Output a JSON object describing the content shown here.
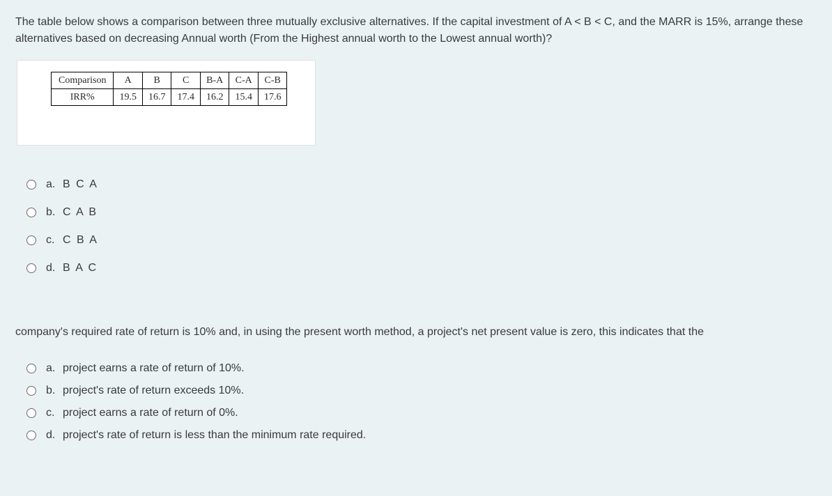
{
  "question1": {
    "text": "The table below shows a comparison between three mutually exclusive alternatives. If the capital investment of A < B < C, and the MARR is 15%, arrange these alternatives based on decreasing Annual worth (From the Highest annual worth to the Lowest annual worth)?",
    "table": {
      "row1": [
        "Comparison",
        "A",
        "B",
        "C",
        "B-A",
        "C-A",
        "C-B"
      ],
      "row2": [
        "IRR%",
        "19.5",
        "16.7",
        "17.4",
        "16.2",
        "15.4",
        "17.6"
      ]
    },
    "options": [
      {
        "letter": "a.",
        "text": "B C A"
      },
      {
        "letter": "b.",
        "text": "C A B"
      },
      {
        "letter": "c.",
        "text": "C B A"
      },
      {
        "letter": "d.",
        "text": "B A C"
      }
    ]
  },
  "question2": {
    "text": "company's required rate of return is 10% and, in using the present worth method, a project's net present value is zero, this indicates that the",
    "options": [
      {
        "letter": "a.",
        "text": "project earns a rate of return of 10%."
      },
      {
        "letter": "b.",
        "text": "project's rate of return exceeds 10%."
      },
      {
        "letter": "c.",
        "text": "project earns a rate of return of 0%."
      },
      {
        "letter": "d.",
        "text": "project's rate of return is less than the minimum rate required."
      }
    ]
  }
}
